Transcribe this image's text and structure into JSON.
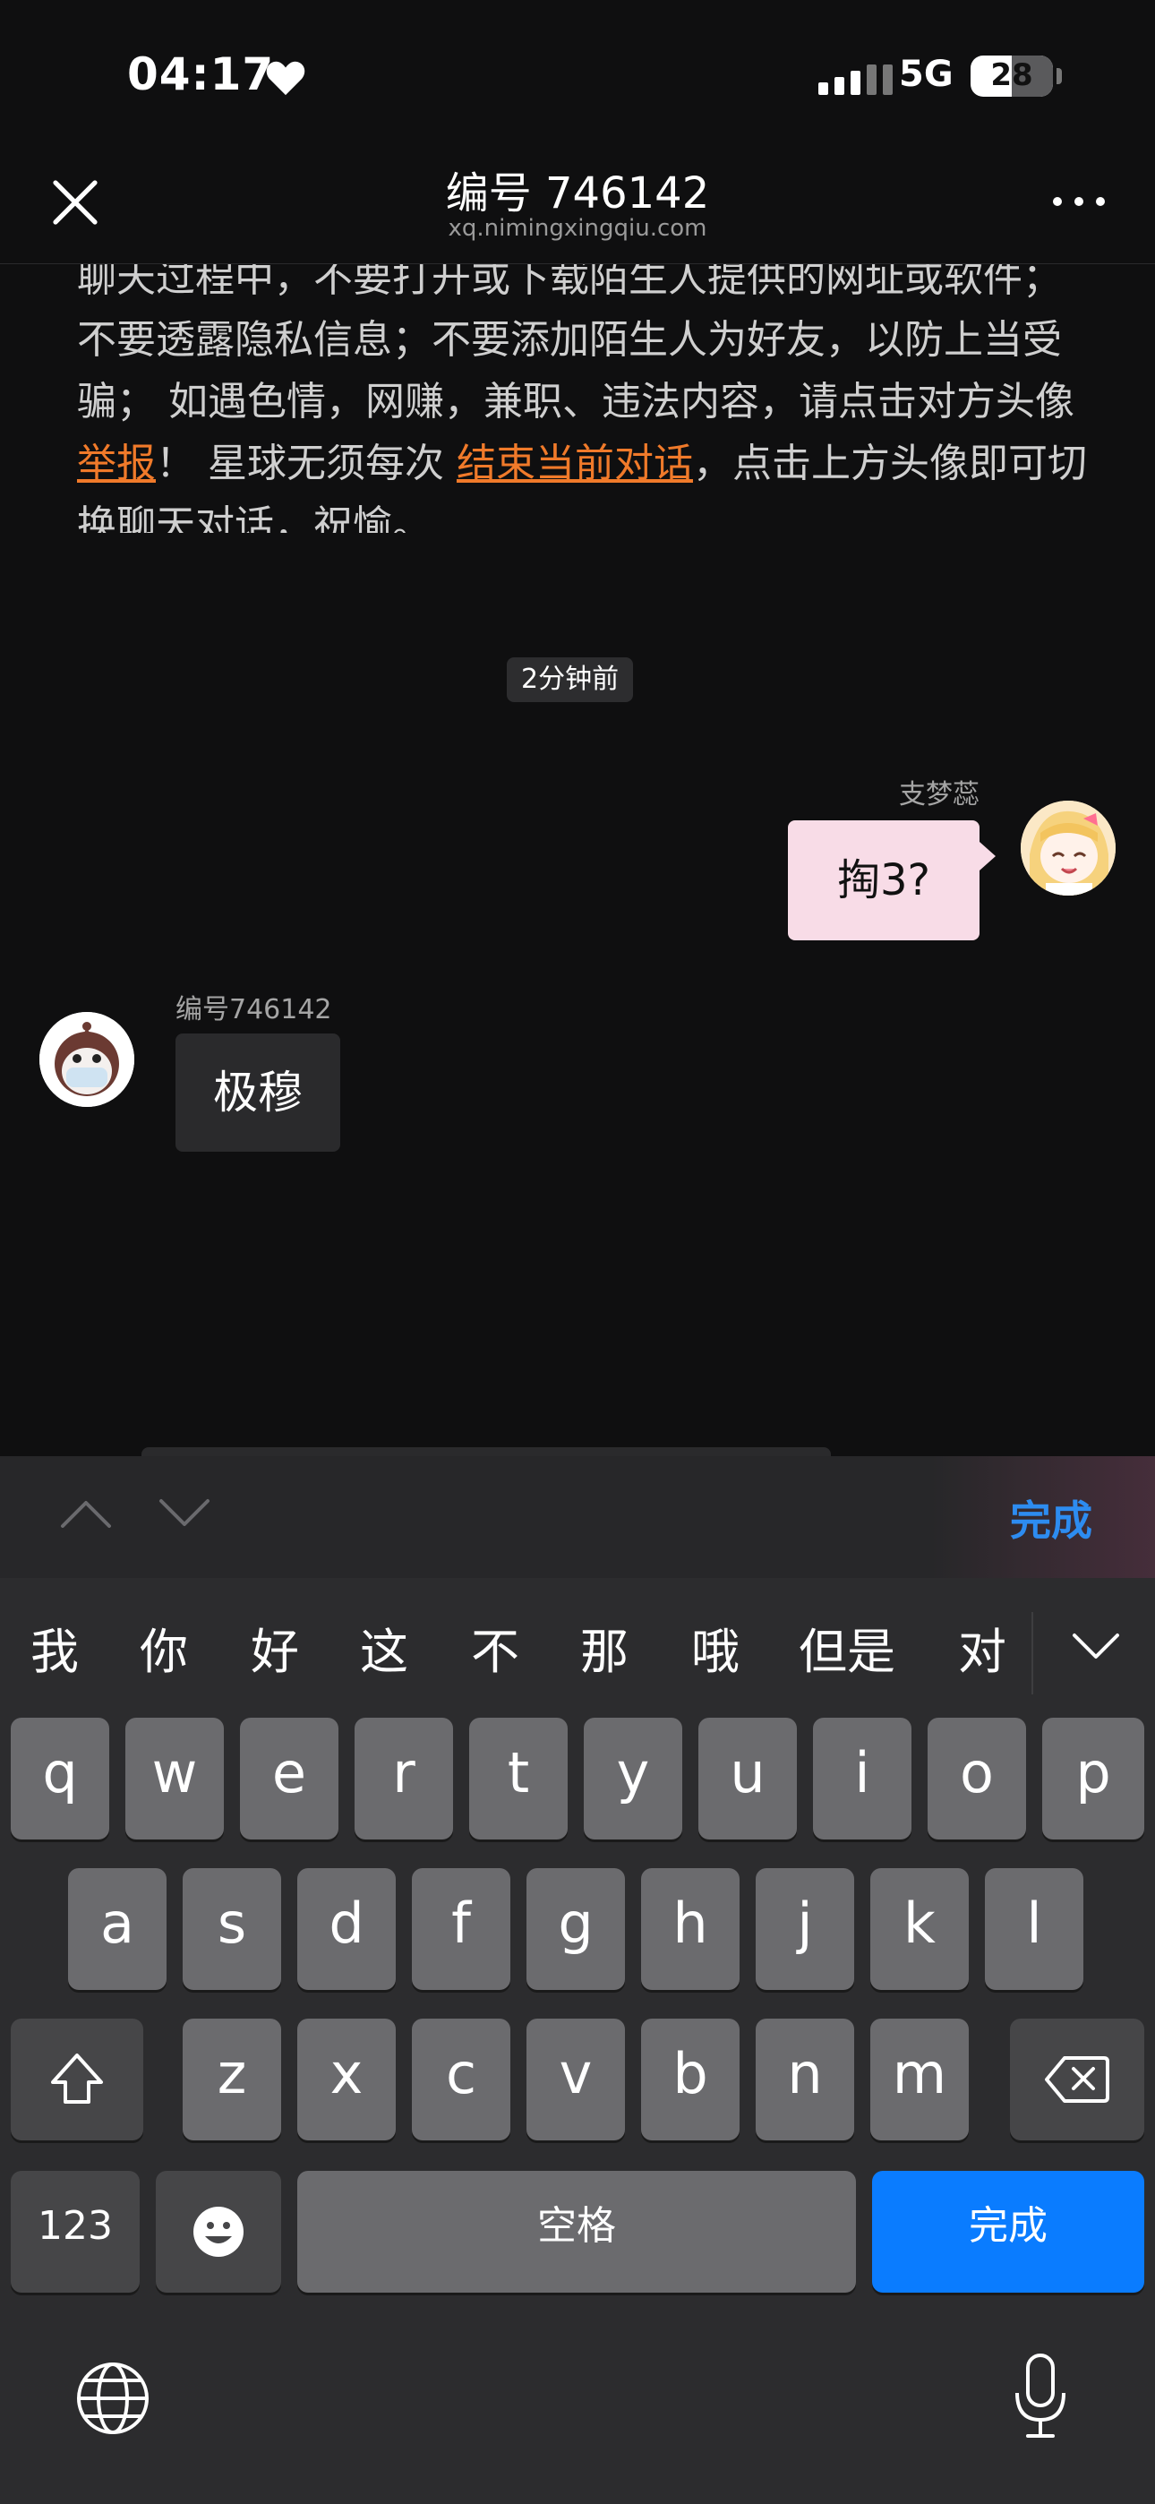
{
  "status_bar": {
    "time": "04:17",
    "network": "5G",
    "battery": "28"
  },
  "header": {
    "title": "编号 746142",
    "subtitle": "xq.nimingxingqiu.com"
  },
  "notice": {
    "part1": "聊天过程中，不要打开或下载陌生人提供的网址或软件；不要透露隐私信息；不要添加陌生人为好友，以防上当受骗； 如遇色情，网赚，兼职、违法内容，请点击对方头像 ",
    "report_link": "举报",
    "part2": "！ 星球无须每次 ",
    "end_link": "结束当前对话",
    "part3": "，点击上方头像即可切换聊天对话，祝愉。"
  },
  "chat": {
    "time_label": "2分钟前",
    "messages": [
      {
        "side": "right",
        "sender": "支梦蕊",
        "text": "掏3?"
      },
      {
        "side": "left",
        "sender": "编号746142",
        "text": "极穆"
      }
    ]
  },
  "keyboard": {
    "done_accessory": "完成",
    "candidates": [
      "我",
      "你",
      "好",
      "这",
      "不",
      "那",
      "哦",
      "但是",
      "对"
    ],
    "row1": [
      "q",
      "w",
      "e",
      "r",
      "t",
      "y",
      "u",
      "i",
      "o",
      "p"
    ],
    "row2": [
      "a",
      "s",
      "d",
      "f",
      "g",
      "h",
      "j",
      "k",
      "l"
    ],
    "row3": [
      "z",
      "x",
      "c",
      "v",
      "b",
      "n",
      "m"
    ],
    "numbers_label": "123",
    "space_label": "空格",
    "done_label": "完成"
  },
  "colors": {
    "link": "#f07a2a",
    "accent_blue": "#0a7cff",
    "bubble_pink": "#f8dce7"
  }
}
